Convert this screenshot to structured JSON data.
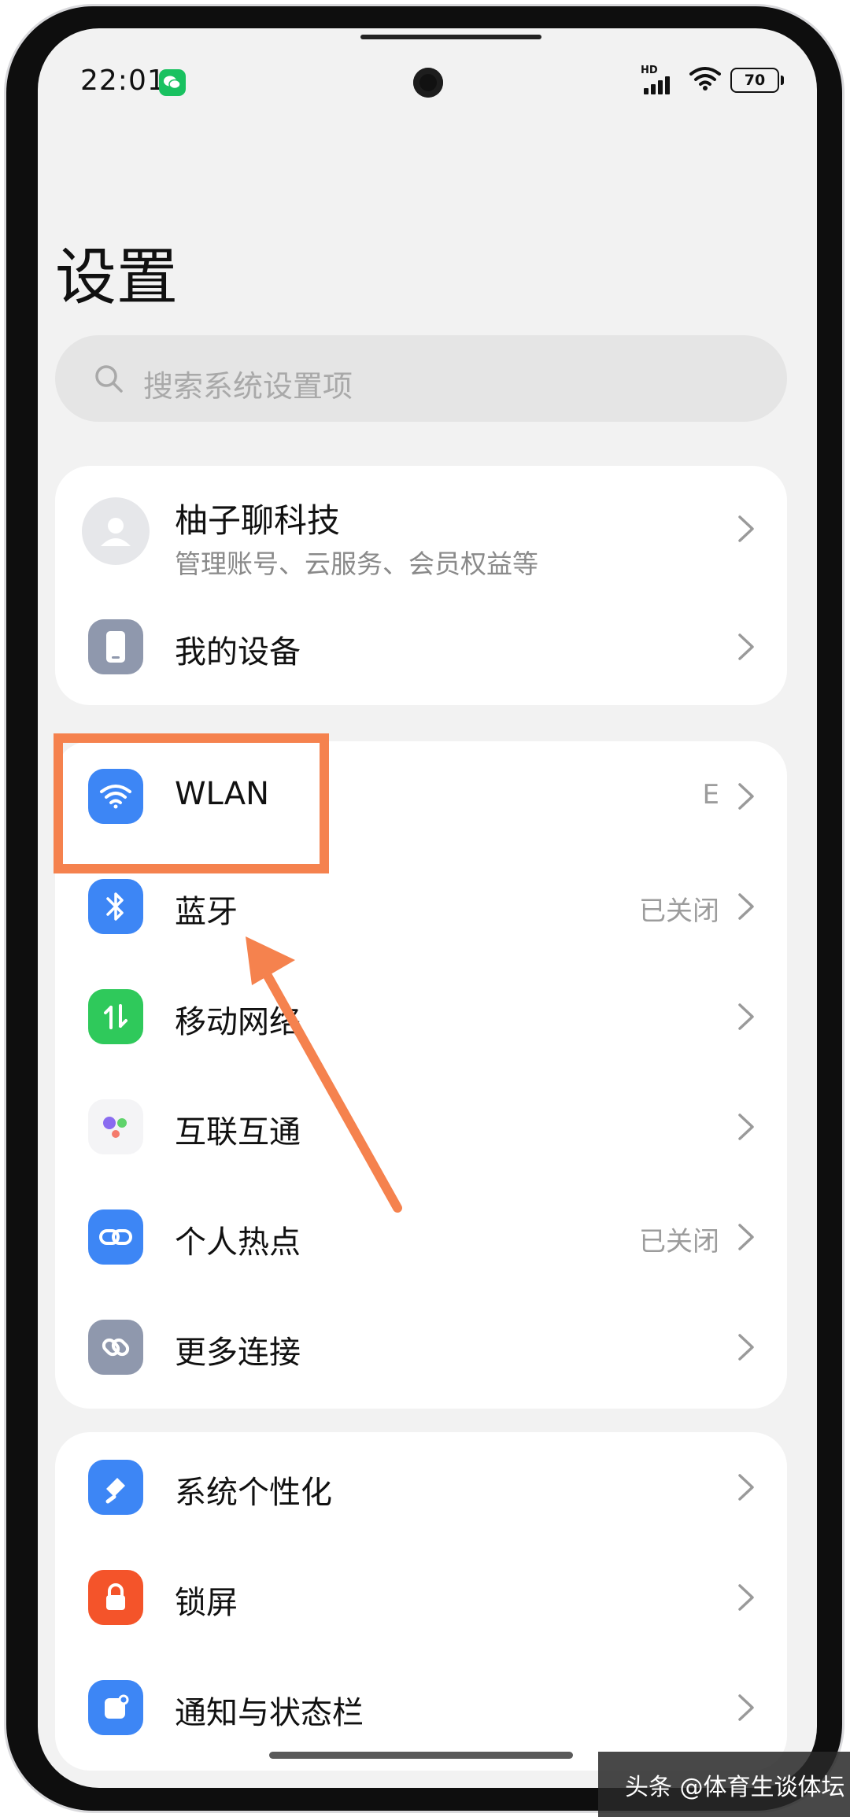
{
  "status_bar": {
    "time": "22:01",
    "network_tag": "HD",
    "battery": "70"
  },
  "page": {
    "title": "设置"
  },
  "search": {
    "placeholder": "搜索系统设置项"
  },
  "account": {
    "name": "柚子聊科技",
    "subtitle": "管理账号、云服务、会员权益等"
  },
  "group1": {
    "my_device": "我的设备"
  },
  "connectivity": [
    {
      "label": "WLAN",
      "value": "E"
    },
    {
      "label": "蓝牙",
      "value": "已关闭"
    },
    {
      "label": "移动网络",
      "value": ""
    },
    {
      "label": "互联互通",
      "value": ""
    },
    {
      "label": "个人热点",
      "value": "已关闭"
    },
    {
      "label": "更多连接",
      "value": ""
    }
  ],
  "personalization": [
    {
      "label": "系统个性化"
    },
    {
      "label": "锁屏"
    },
    {
      "label": "通知与状态栏"
    }
  ],
  "watermark": "头条 @体育生谈体坛",
  "colors": {
    "blue_icon": "#3d86f5",
    "green_icon": "#2fc95b",
    "orange_icon": "#f4542a",
    "gray_icon": "#8f98ad",
    "annotation": "#f5824e"
  }
}
